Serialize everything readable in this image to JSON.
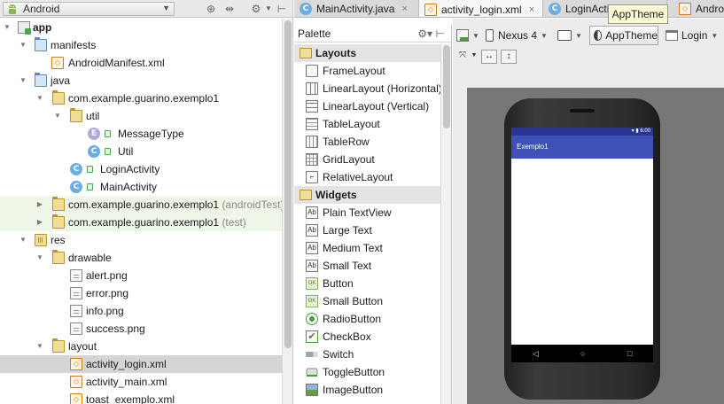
{
  "project_panel": {
    "selector_label": "Android",
    "toolbar_icons": [
      "globe-icon",
      "collapse-icon",
      "gear-icon",
      "hide-panel-icon"
    ],
    "tree": [
      {
        "label": "app",
        "bold": true,
        "icon": "app-module-icon",
        "expanded": true
      },
      {
        "label": "manifests",
        "icon": "folder-icon",
        "expanded": true
      },
      {
        "label": "AndroidManifest.xml",
        "icon": "xml-file-icon"
      },
      {
        "label": "java",
        "icon": "folder-icon",
        "expanded": true
      },
      {
        "label": "com.example.guarino.exemplo1",
        "icon": "package-icon",
        "expanded": true
      },
      {
        "label": "util",
        "icon": "package-icon",
        "expanded": true
      },
      {
        "label": "MessageType",
        "icon": "enum-icon"
      },
      {
        "label": "Util",
        "icon": "class-icon"
      },
      {
        "label": "LoginActivity",
        "icon": "class-icon"
      },
      {
        "label": "MainActivity",
        "icon": "class-icon"
      },
      {
        "label": "com.example.guarino.exemplo1",
        "suffix": "(androidTest)",
        "icon": "package-icon",
        "expanded": false
      },
      {
        "label": "com.example.guarino.exemplo1",
        "suffix": "(test)",
        "icon": "package-icon",
        "expanded": false
      },
      {
        "label": "res",
        "icon": "res-folder-icon",
        "expanded": true
      },
      {
        "label": "drawable",
        "icon": "package-icon",
        "expanded": true
      },
      {
        "label": "alert.png",
        "icon": "image-file-icon"
      },
      {
        "label": "error.png",
        "icon": "image-file-icon"
      },
      {
        "label": "info.png",
        "icon": "image-file-icon"
      },
      {
        "label": "success.png",
        "icon": "image-file-icon"
      },
      {
        "label": "layout",
        "icon": "package-icon",
        "expanded": true
      },
      {
        "label": "activity_login.xml",
        "icon": "xml-file-icon",
        "selected": true
      },
      {
        "label": "activity_main.xml",
        "icon": "xml-file-icon"
      },
      {
        "label": "toast_exemplo.xml",
        "icon": "xml-file-icon"
      }
    ]
  },
  "tabs": [
    {
      "label": "MainActivity.java",
      "icon": "class-icon",
      "close": "×"
    },
    {
      "label": "activity_login.xml",
      "icon": "xml-file-icon",
      "close": "×",
      "active": true
    },
    {
      "label": "LoginActi",
      "icon": "class-icon"
    },
    {
      "label": "Andro",
      "icon": "xml-file-icon"
    }
  ],
  "palette": {
    "title": "Palette",
    "groups": [
      {
        "name": "Layouts",
        "items": [
          "FrameLayout",
          "LinearLayout (Horizontal)",
          "LinearLayout (Vertical)",
          "TableLayout",
          "TableRow",
          "GridLayout",
          "RelativeLayout"
        ]
      },
      {
        "name": "Widgets",
        "items": [
          "Plain TextView",
          "Large Text",
          "Medium Text",
          "Small Text",
          "Button",
          "Small Button",
          "RadioButton",
          "CheckBox",
          "Switch",
          "ToggleButton",
          "ImageButton"
        ]
      }
    ]
  },
  "design_toolbar": {
    "device": "Nexus 4",
    "theme": "AppTheme",
    "activity": "Login",
    "tooltip": "AppTheme"
  },
  "preview": {
    "app_title": "Exemplo1",
    "status_time": "6:00",
    "nav_back": "◁",
    "nav_home": "○",
    "nav_recent": "□",
    "statusbar_color": "#283593",
    "appbar_color": "#3f51b5"
  }
}
